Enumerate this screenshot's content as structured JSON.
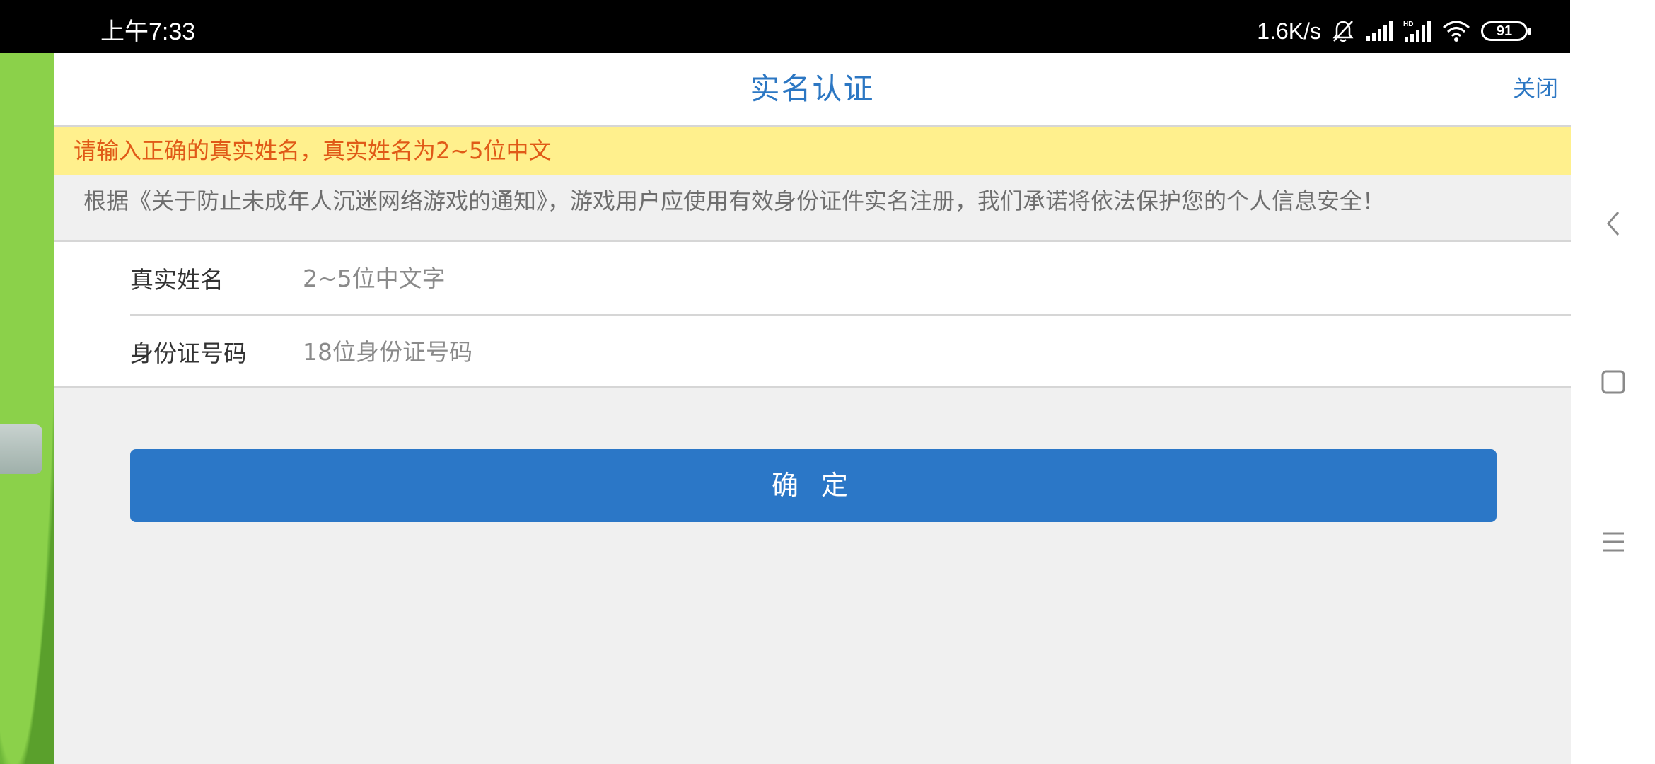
{
  "status_bar": {
    "time": "上午7:33",
    "network_speed": "1.6K/s",
    "battery_level": "91",
    "icons": [
      "mute-bell-icon",
      "signal-icon",
      "hd-signal-icon",
      "wifi-icon",
      "battery-icon"
    ]
  },
  "dialog": {
    "title": "实名认证",
    "close_label": "关闭",
    "warning": "请输入正确的真实姓名，真实姓名为2~5位中文",
    "notice": "根据《关于防止未成年人沉迷网络游戏的通知》，游戏用户应使用有效身份证件实名注册，我们承诺将依法保护您的个人信息安全！",
    "fields": [
      {
        "label": "真实姓名",
        "value": "",
        "placeholder": "2~5位中文字"
      },
      {
        "label": "身份证号码",
        "value": "",
        "placeholder": "18位身份证号码"
      }
    ],
    "confirm_label": "确 定"
  },
  "nav_bar": {
    "icons": [
      "back-chevron-icon",
      "home-square-icon",
      "menu-lines-icon"
    ]
  },
  "colors": {
    "accent": "#2b77c7",
    "warning_bg": "#fff08d",
    "warning_text": "#e05a17",
    "notice_text": "#6e6e6e"
  }
}
